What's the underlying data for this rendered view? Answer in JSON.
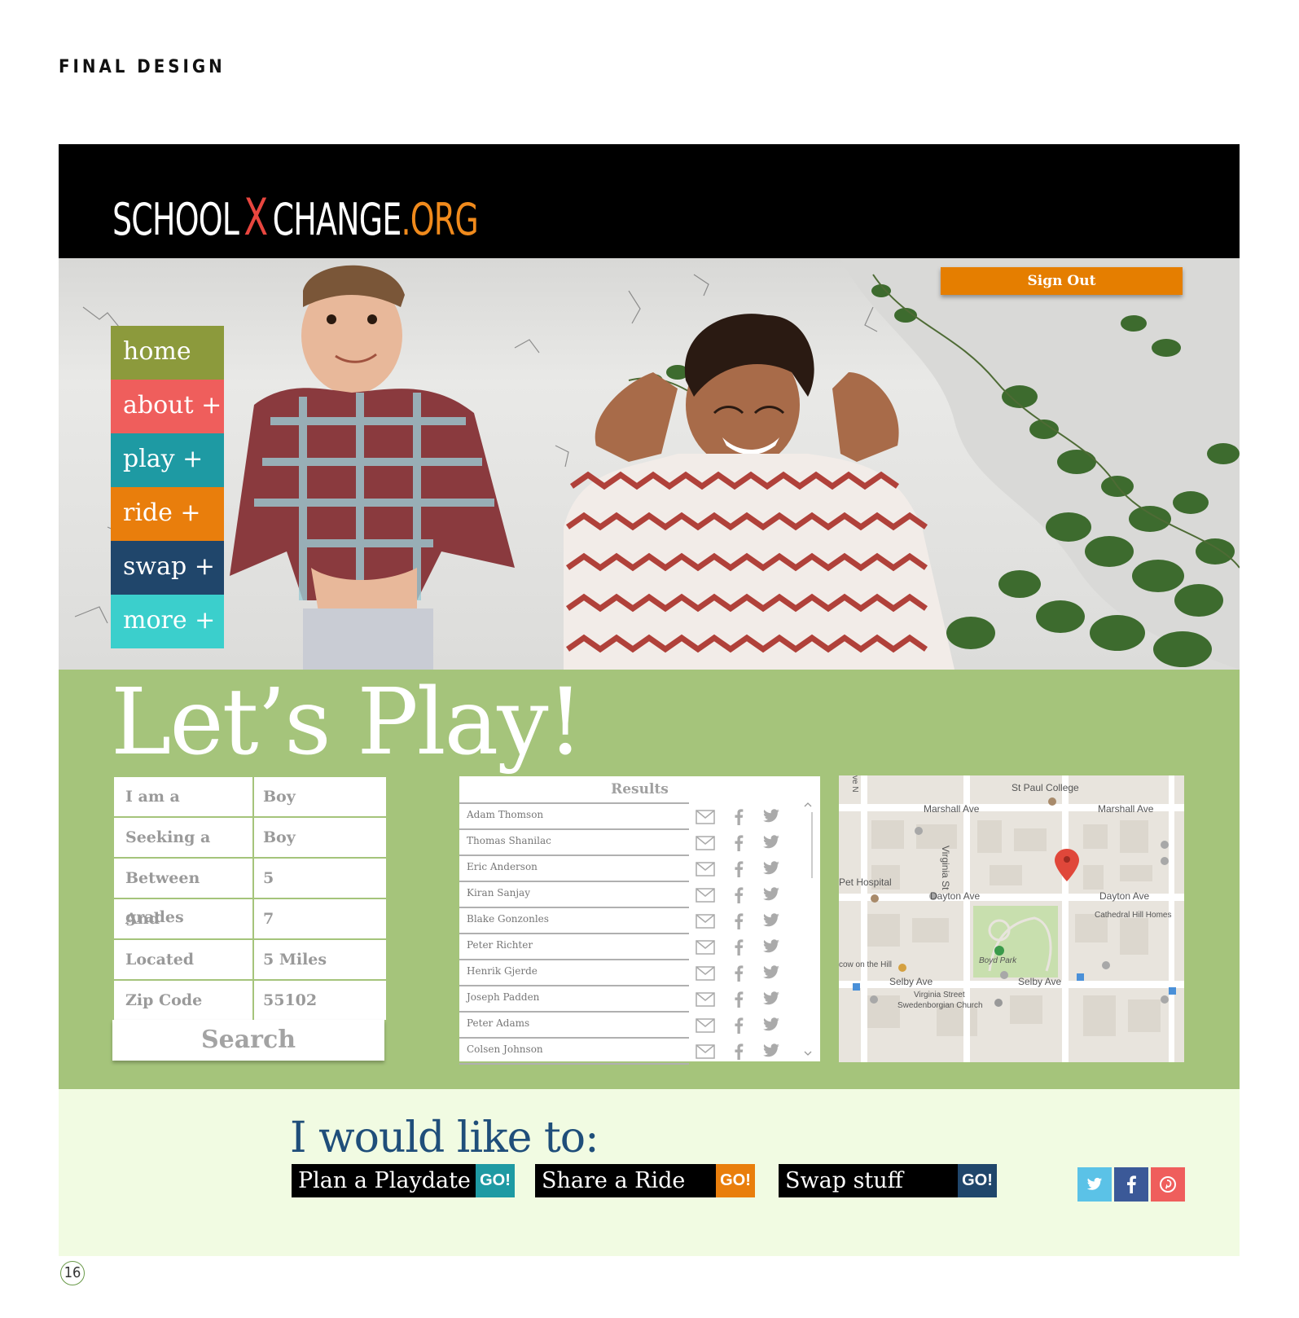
{
  "page_heading": "FINAL DESIGN",
  "page_number": "16",
  "logo": {
    "part1": "SCHOOL",
    "part2": "X",
    "part3": "CHANGE",
    "part4": ".ORG"
  },
  "header": {
    "signout_label": "Sign Out"
  },
  "nav": {
    "items": [
      {
        "label": "home",
        "color": "#8c9a3c"
      },
      {
        "label": "about +",
        "color": "#ef5e5c"
      },
      {
        "label": "play +",
        "color": "#1e9aa3"
      },
      {
        "label": "ride +",
        "color": "#e97e0c"
      },
      {
        "label": "swap +",
        "color": "#20466b"
      },
      {
        "label": "more +",
        "color": "#3bcfcc"
      }
    ]
  },
  "play": {
    "title": "Let’s Play!",
    "form": [
      {
        "label": "I am a",
        "value": "Boy"
      },
      {
        "label": "Seeking a",
        "value": "Boy"
      },
      {
        "label": "Between grades",
        "value": "5"
      },
      {
        "label": "And",
        "value": "7"
      },
      {
        "label": "Located",
        "value": "5 Miles"
      },
      {
        "label": "Zip Code",
        "value": "55102"
      }
    ],
    "search_label": "Search",
    "results_title": "Results",
    "results": [
      "Adam Thomson",
      "Thomas Shanilac",
      "Eric Anderson",
      "Kiran Sanjay",
      "Blake Gonzonles",
      "Peter Richter",
      "Henrik Gjerde",
      "Joseph Padden",
      "Peter Adams",
      "Colsen Johnson"
    ],
    "map_labels": {
      "st_paul_college": "St Paul College",
      "marshall_ave_1": "Marshall Ave",
      "marshall_ave_2": "Marshall Ave",
      "virginia_st": "Virginia St",
      "pet_hospital": "Pet Hospital",
      "dayton_ave_1": "Dayton Ave",
      "dayton_ave_2": "Dayton Ave",
      "cathedral_hill": "Cathedral Hill Homes",
      "boyd_park": "Boyd Park",
      "cow_on_the_hill": "cow on the Hill",
      "selby_ave_1": "Selby Ave",
      "selby_ave_2": "Selby Ave",
      "church_1": "Virginia Street",
      "church_2": "Swedenborgian Church",
      "ave_n": "ve N"
    }
  },
  "actions": {
    "heading": "I would like to:",
    "buttons": [
      {
        "label": "Plan a Playdate",
        "go": "GO!",
        "go_color": "#1e9aa3"
      },
      {
        "label": "Share a Ride",
        "go": "GO!",
        "go_color": "#e97e0c"
      },
      {
        "label": "Swap stuff",
        "go": "GO!",
        "go_color": "#20466b"
      }
    ],
    "social": [
      {
        "icon": "twitter-icon",
        "color": "#5bc2e7"
      },
      {
        "icon": "facebook-icon",
        "color": "#3b5998"
      },
      {
        "icon": "pinterest-icon",
        "color": "#ef5e5c"
      }
    ]
  }
}
